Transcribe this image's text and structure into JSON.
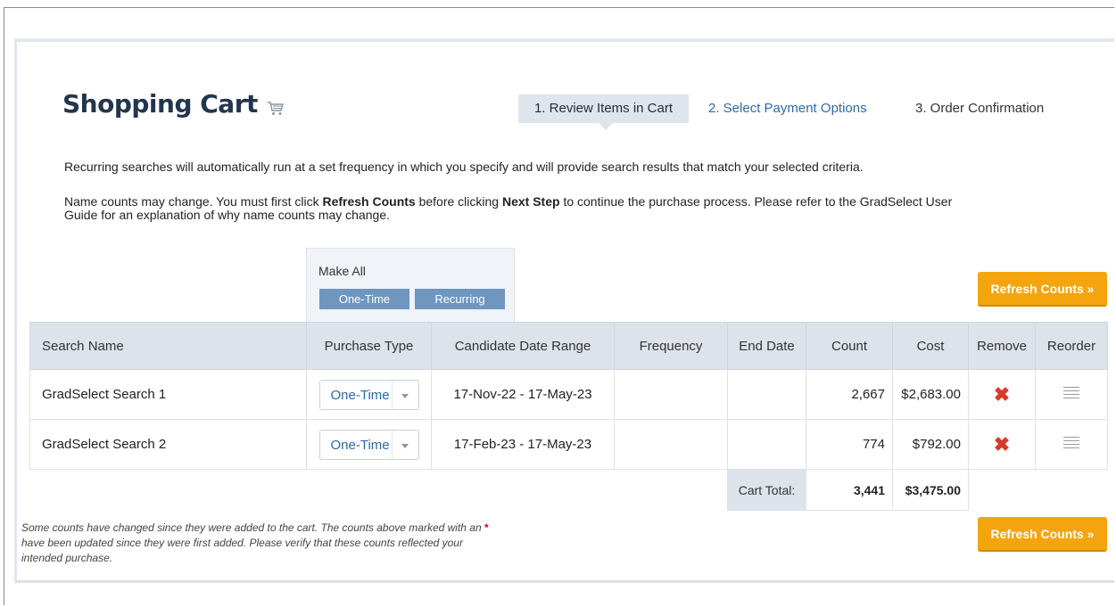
{
  "header": {
    "title": "Shopping Cart",
    "cart_icon": "shopping-cart-icon"
  },
  "steps": [
    {
      "label": "1. Review Items in Cart",
      "active": true
    },
    {
      "label": "2. Select Payment Options",
      "active": false
    },
    {
      "label": "3. Order Confirmation",
      "active": false
    }
  ],
  "info": {
    "recurring_text": "Recurring searches will automatically run at a set frequency in which you specify and will provide search results that match your selected criteria.",
    "counts_pre": "Name counts may change. You must first click ",
    "counts_bold1": "Refresh Counts",
    "counts_mid": " before clicking ",
    "counts_bold2": "Next Step",
    "counts_post": " to continue the purchase process. Please refer to the GradSelect User Guide for an explanation of why name counts may change."
  },
  "make_all": {
    "label": "Make All",
    "one_time": "One-Time",
    "recurring": "Recurring"
  },
  "refresh_label": "Refresh Counts »",
  "table": {
    "headers": [
      "Search Name",
      "Purchase Type",
      "Candidate Date Range",
      "Frequency",
      "End Date",
      "Count",
      "Cost",
      "Remove",
      "Reorder"
    ],
    "rows": [
      {
        "name": "GradSelect Search 1",
        "purchase_type": "One-Time",
        "date_range": "17-Nov-22 - 17-May-23",
        "frequency": "",
        "end_date": "",
        "count": "2,667",
        "cost": "$2,683.00"
      },
      {
        "name": "GradSelect Search 2",
        "purchase_type": "One-Time",
        "date_range": "17-Feb-23 - 17-May-23",
        "frequency": "",
        "end_date": "",
        "count": "774",
        "cost": "$792.00"
      }
    ],
    "remove_icon": "remove-x-icon",
    "reorder_icon": "drag-handle-icon",
    "total_label": "Cart Total:",
    "total_count": "3,441",
    "total_cost": "$3,475.00"
  },
  "note": {
    "pre": "Some counts have changed since they were added to the cart. The counts above marked with an ",
    "star": "*",
    "post": " have been updated since they were first added. Please verify that these counts reflected your intended purchase."
  },
  "colors": {
    "title": "#24364d",
    "link": "#2e6aa3",
    "accent_orange": "#f4a50e",
    "make_all_button": "#6e96bf",
    "remove_red": "#d93a2b"
  }
}
